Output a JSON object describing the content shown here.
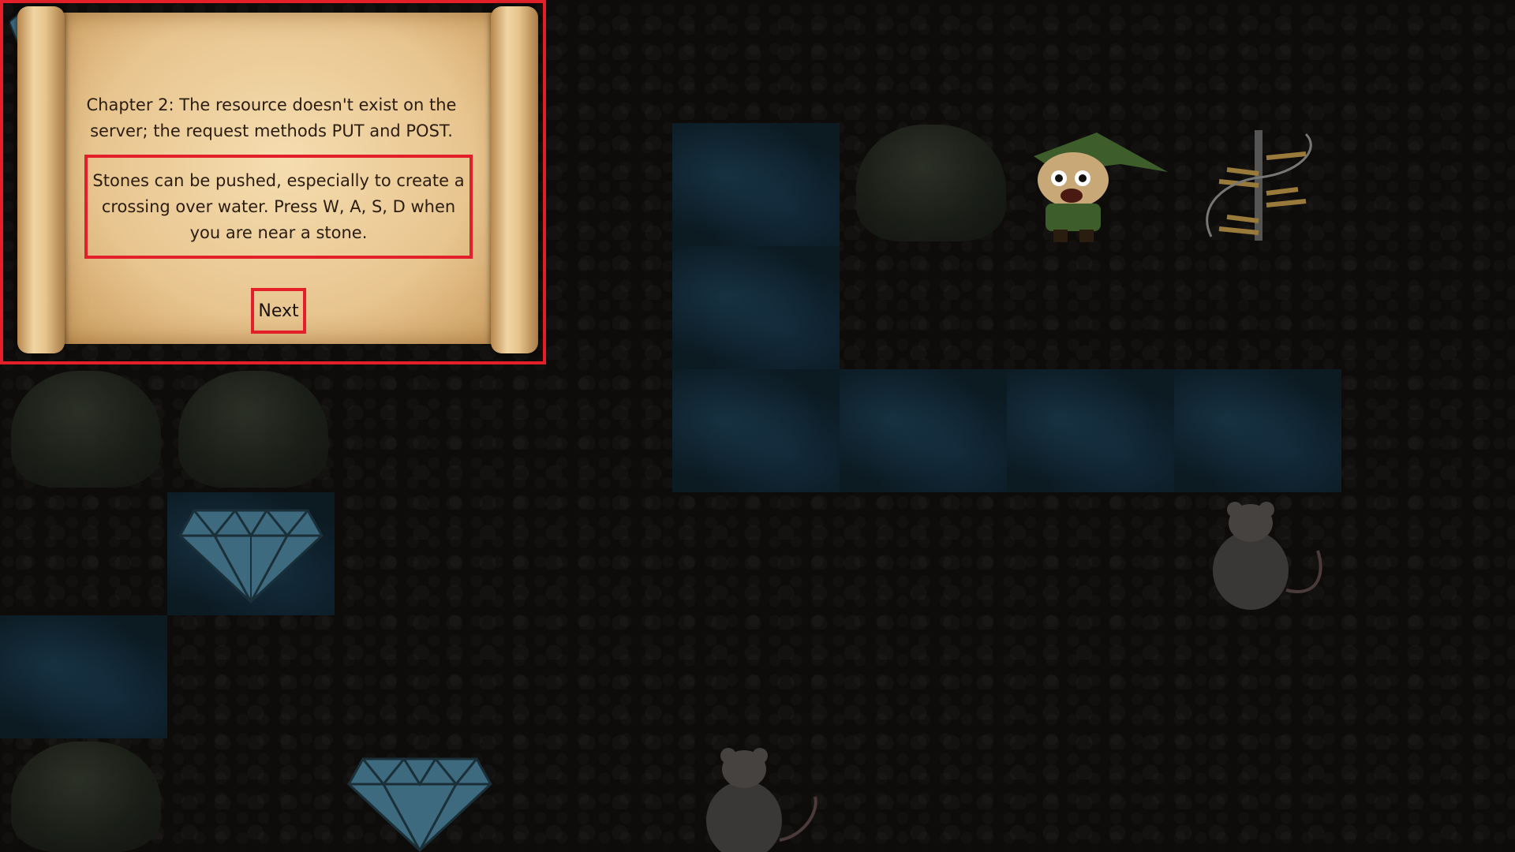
{
  "dialog": {
    "chapter_text": "Chapter 2: The resource doesn't exist on the server; the request methods PUT and POST.",
    "hint_text": "Stones can be pushed, especially to create a crossing over water. Press W, A, S, D when you are near a stone.",
    "next_label": "Next"
  },
  "board": {
    "icons": [
      "stone-icon",
      "water-tile",
      "diamond-icon",
      "rat-icon",
      "hero-icon",
      "stairs-icon"
    ]
  }
}
